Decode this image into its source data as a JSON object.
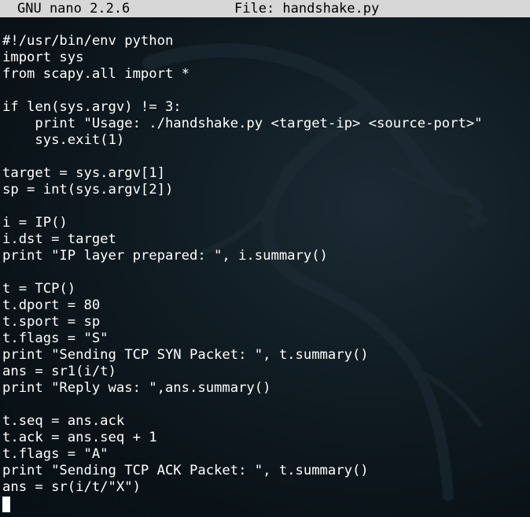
{
  "titlebar": {
    "app": "GNU nano 2.2.6",
    "file_label": "File: handshake.py"
  },
  "editor": {
    "lines": [
      "#!/usr/bin/env python",
      "import sys",
      "from scapy.all import *",
      "",
      "if len(sys.argv) != 3:",
      "    print \"Usage: ./handshake.py <target-ip> <source-port>\"",
      "    sys.exit(1)",
      "",
      "target = sys.argv[1]",
      "sp = int(sys.argv[2])",
      "",
      "i = IP()",
      "i.dst = target",
      "print \"IP layer prepared: \", i.summary()",
      "",
      "t = TCP()",
      "t.dport = 80",
      "t.sport = sp",
      "t.flags = \"S\"",
      "print \"Sending TCP SYN Packet: \", t.summary()",
      "ans = sr1(i/t)",
      "print \"Reply was: \",ans.summary()",
      "",
      "t.seq = ans.ack",
      "t.ack = ans.seq + 1",
      "t.flags = \"A\"",
      "print \"Sending TCP ACK Packet: \", t.summary()",
      "ans = sr(i/t/\"X\")"
    ]
  },
  "icons": {
    "watermark": "kali-dragon-watermark",
    "cursor": "text-cursor"
  },
  "colors": {
    "background": "#0f1a21",
    "titlebar_bg": "#d7d7d7",
    "text": "#ffffff"
  }
}
